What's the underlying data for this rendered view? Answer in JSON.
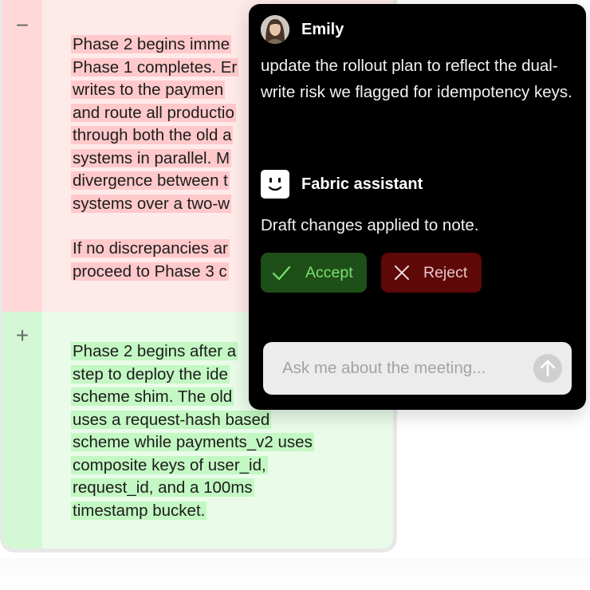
{
  "diff": {
    "removed": {
      "sign": "−",
      "paragraphs": [
        [
          "Phase 2 begins imme",
          "Phase 1 completes. Er",
          "writes to the paymen",
          "and route all productio",
          "through both the old a",
          "systems in parallel. M",
          "divergence between t",
          "systems over a two-w"
        ],
        [
          "If no discrepancies ar",
          "proceed to Phase 3 c"
        ]
      ]
    },
    "added": {
      "sign": "+",
      "paragraphs": [
        [
          "Phase 2 begins after a",
          "step to deploy the ide",
          "scheme shim. The old",
          "uses a request-hash based",
          "scheme while payments_v2 uses",
          "composite keys of user_id,",
          "request_id, and a 100ms",
          "timestamp bucket."
        ]
      ]
    }
  },
  "chat": {
    "user_message": {
      "sender": "Emily",
      "text": "update the rollout plan to reflect the dual-write risk we flagged for idempotency keys."
    },
    "assistant_message": {
      "sender": "Fabric assistant",
      "text": "Draft changes applied to note."
    },
    "actions": {
      "accept_label": "Accept",
      "reject_label": "Reject"
    },
    "input": {
      "placeholder": "Ask me about the meeting...",
      "value": ""
    },
    "icons": {
      "avatar": "user-avatar",
      "assistant": "smiley-face-icon",
      "accept": "checkmark-icon",
      "reject": "x-icon",
      "send": "arrow-up-icon"
    }
  },
  "colors": {
    "removed_highlight": "#ffc9cb",
    "added_highlight": "#c3f7c3",
    "accept_bg": "#1f4f18",
    "accept_text": "#78e070",
    "reject_bg": "#5e0808",
    "panel_bg": "#000000"
  }
}
